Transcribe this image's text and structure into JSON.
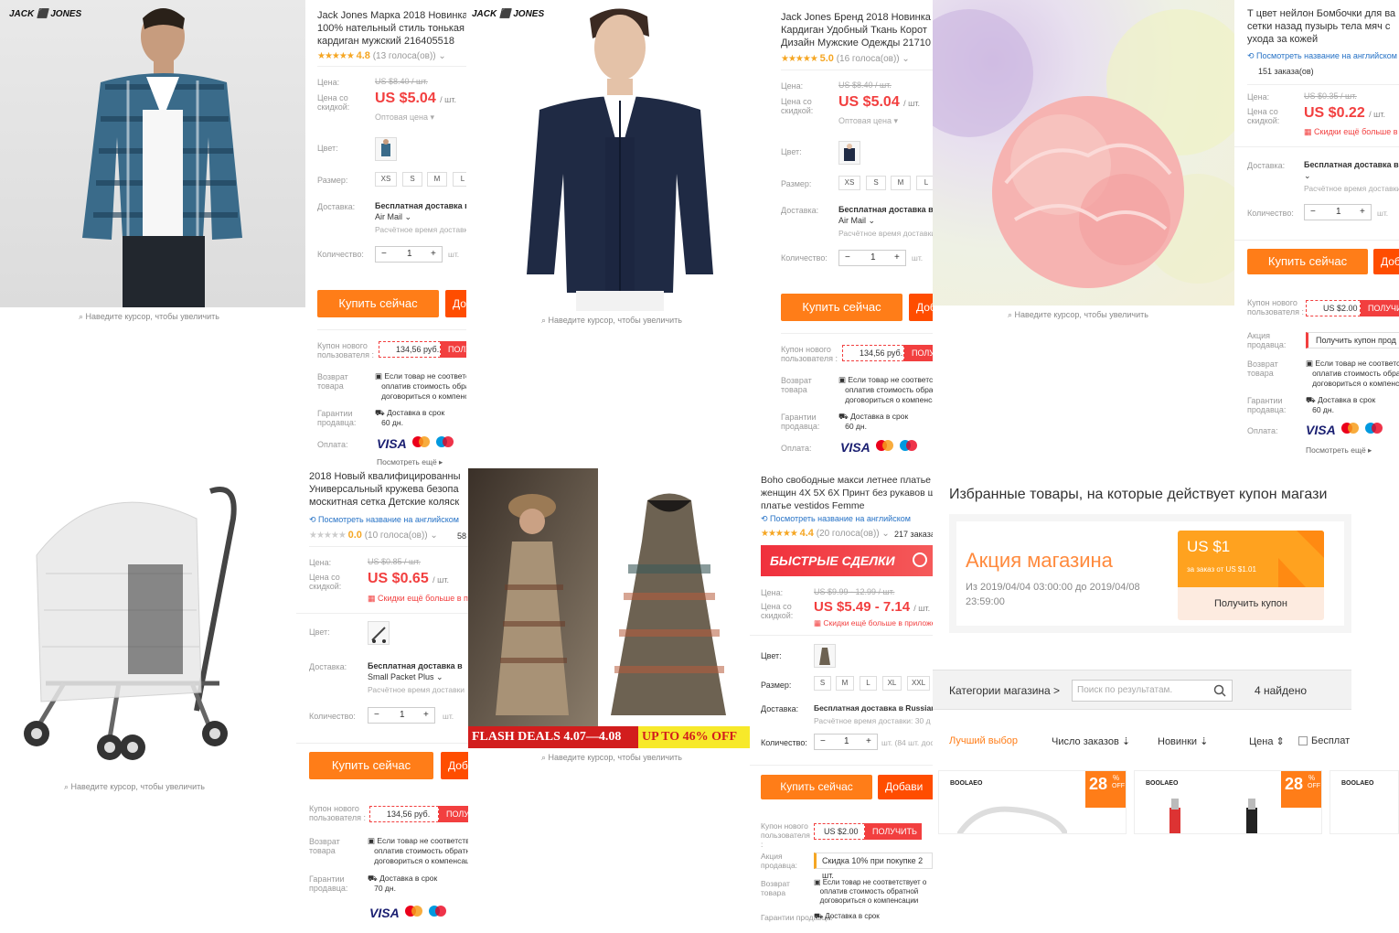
{
  "hint": "Наведите курсор, чтобы увеличить",
  "labels": {
    "price": "Цена:",
    "discount_price": "Цена со скидкой:",
    "color": "Цвет:",
    "size": "Размер:",
    "delivery": "Доставка:",
    "quantity": "Количество:",
    "new_user_coupon": "Купон нового пользователя :",
    "seller_promo": "Акция продавца:",
    "return": "Возврат товара",
    "guarantee": "Гарантии продавца:",
    "payment": "Оплата:",
    "wholesale": "Оптовая цена ▾",
    "per_unit": "/ шт.",
    "unit": "шт.",
    "buy_now": "Купить сейчас",
    "add": "Добави",
    "get": "ПОЛУЧИТЬ",
    "see_more": "Посмотреть ещё ▸",
    "translate_link": "Посмотреть название на английском",
    "return_text_1": "Если товар не соответствует о",
    "return_text_2": "оплатив стоимость обратной",
    "return_text_3": "договориться о компенсации",
    "delivery_ontime": "Доставка в срок",
    "est_time": "Расчётное время доставки",
    "more_discounts": "Скидки ещё больше в приложении",
    "visa": "VISA"
  },
  "products": [
    {
      "brand": "JACK ⬛ JONES",
      "title_1": "Jack Jones Марка 2018 Новинка",
      "title_2": "100% нательный стиль тонькая",
      "title_3": "кардиган мужский 216405518",
      "rating": "4.8",
      "reviews": "(13 голоса(ов)) ⌄",
      "old_price": "US $8.40 / шт.",
      "price": "US $5.04",
      "sizes": [
        "XS",
        "S",
        "M",
        "L"
      ],
      "delivery": "Бесплатная доставка в",
      "carrier": "Air Mail ⌄",
      "qty": "1",
      "coupon": "134,56 руб.",
      "guarantee_days": "60 дн."
    },
    {
      "brand": "JACK ⬛ JONES",
      "title_1": "Jack Jones Бренд 2018 Новинка М",
      "title_2": "Кардиган Удобный Ткань Корот",
      "title_3": "Дизайн Мужские Одежды 21710",
      "rating": "5.0",
      "reviews": "(16 голоса(ов)) ⌄",
      "old_price": "US $8.40 / шт.",
      "price": "US $5.04",
      "sizes": [
        "XS",
        "S",
        "M",
        "L"
      ],
      "delivery": "Бесплатная доставка в",
      "carrier": "Air Mail ⌄",
      "qty": "1",
      "coupon": "134,56 руб.",
      "guarantee_days": "60 дн."
    },
    {
      "title_1": "Т цвет нейлон Бомбочки для ва",
      "title_2": "сетки назад пузырь тела мяч с",
      "title_3": "ухода за кожей",
      "orders": "151 заказа(ов)",
      "old_price": "US $0.35 / шт.",
      "price": "US $0.22",
      "delivery": "Бесплатная доставка в",
      "qty": "1",
      "coupon": "US $2.00",
      "seller_coupon": "Получить купон прод",
      "guarantee_days": "60 дн."
    },
    {
      "title_1": "2018 Новый квалифицированны",
      "title_2": "Универсальный кружева безопа",
      "title_3": "москитная сетка Детские коляск",
      "rating": "0.0",
      "reviews": "(10 голоса(ов)) ⌄",
      "orders": "58",
      "old_price": "US $0.85 / шт.",
      "price": "US $0.65",
      "delivery": "Бесплатная доставка в",
      "carrier": "Small Packet Plus ⌄",
      "qty": "1",
      "coupon": "134,56 руб.",
      "guarantee_days": "70 дн."
    },
    {
      "title_1": "Boho свободные макси летнее платье 6",
      "title_2": "женщин 4X 5X 6X Принт без рукавов ш",
      "title_3": "платье vestidos Femme",
      "rating": "4.4",
      "reviews": "(20 голоса(ов)) ⌄",
      "orders": "217 заказа",
      "flash_banner": "БЫСТРЫЕ СДЕЛКИ",
      "old_price": "US $9.99 - 12.99 / шт.",
      "price": "US $5.49 - 7.14",
      "sizes": [
        "S",
        "M",
        "L",
        "XL",
        "XXL"
      ],
      "delivery": "Бесплатная доставка в Russian",
      "est": "Расчётное время доставки: 30 д",
      "qty": "1",
      "qty_note": "шт. (84 шт. дос",
      "coupon": "US $2.00",
      "seller_promo": "Скидка 10% при покупке 2 шт.",
      "flash_left": "FLASH DEALS  4.07—4.08",
      "flash_right": "UP TO 46% OFF"
    }
  ],
  "store": {
    "header": "Избранные товары, на которые действует купон магази",
    "promo_title": "Акция магазина",
    "promo_dates_1": "Из 2019/04/04 03:00:00 до 2019/04/08",
    "promo_dates_2": "23:59:00",
    "coupon_amount": "US $1",
    "coupon_cond": "за заказ от US $1.01",
    "coupon_btn": "Получить купон",
    "categories": "Категории магазина >",
    "search_placeholder": "Поиск по результатам.",
    "found": "4 найдено",
    "sort": [
      "Лучший выбор",
      "Число заказов ⇣",
      "Новинки ⇣",
      "Цена ⇕"
    ],
    "free_ship": "Бесплат",
    "card_brand": "BOOLAEO",
    "badge_num": "28",
    "badge_pct": "%",
    "badge_off": "OFF",
    "accent": "#ff7d18"
  }
}
